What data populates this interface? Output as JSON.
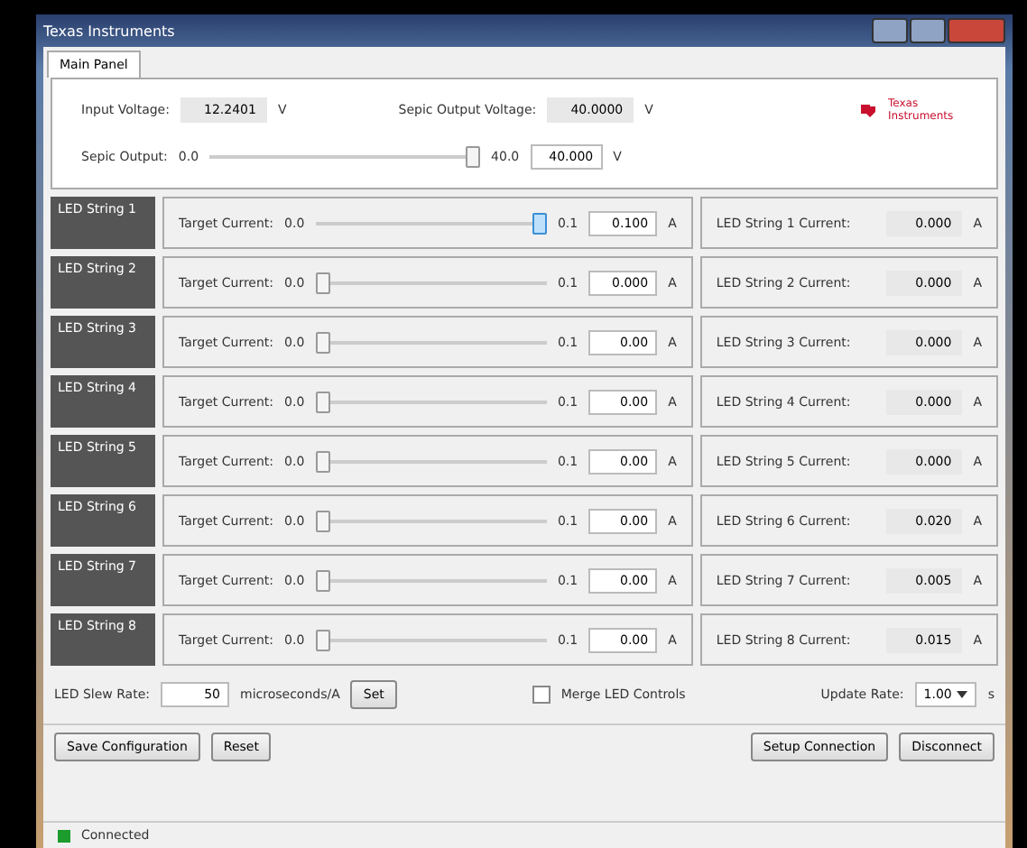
{
  "window": {
    "title": "Texas Instruments"
  },
  "tabs": [
    {
      "label": "Main Panel",
      "selected": true
    }
  ],
  "header": {
    "input_voltage": {
      "label": "Input Voltage:",
      "value": "12.2401",
      "unit": "V"
    },
    "sepic_voltage": {
      "label": "Sepic Output Voltage:",
      "value": "40.0000",
      "unit": "V"
    },
    "logo": "Texas Instruments",
    "sepic_output": {
      "label": "Sepic Output:",
      "min": "0.0",
      "max": "40.0",
      "level": 1,
      "value": "40.000",
      "unit": "V"
    }
  },
  "strings": [
    {
      "name": "LED String 1",
      "target_label": "Target Current:",
      "min": "0.0",
      "max": "0.1",
      "level": 1,
      "focused": true,
      "value": "0.100",
      "unit": "A",
      "current_label": "LED String 1 Current:",
      "current": "0.000",
      "current_unit": "A"
    },
    {
      "name": "LED String 2",
      "target_label": "Target Current:",
      "min": "0.0",
      "max": "0.1",
      "level": 0,
      "focused": false,
      "value": "0.000",
      "unit": "A",
      "current_label": "LED String 2 Current:",
      "current": "0.000",
      "current_unit": "A"
    },
    {
      "name": "LED String 3",
      "target_label": "Target Current:",
      "min": "0.0",
      "max": "0.1",
      "level": 0,
      "focused": false,
      "value": "0.00",
      "unit": "A",
      "current_label": "LED String 3 Current:",
      "current": "0.000",
      "current_unit": "A"
    },
    {
      "name": "LED String 4",
      "target_label": "Target Current:",
      "min": "0.0",
      "max": "0.1",
      "level": 0,
      "focused": false,
      "value": "0.00",
      "unit": "A",
      "current_label": "LED String 4 Current:",
      "current": "0.000",
      "current_unit": "A"
    },
    {
      "name": "LED String 5",
      "target_label": "Target Current:",
      "min": "0.0",
      "max": "0.1",
      "level": 0,
      "focused": false,
      "value": "0.00",
      "unit": "A",
      "current_label": "LED String 5 Current:",
      "current": "0.000",
      "current_unit": "A"
    },
    {
      "name": "LED String 6",
      "target_label": "Target Current:",
      "min": "0.0",
      "max": "0.1",
      "level": 0,
      "focused": false,
      "value": "0.00",
      "unit": "A",
      "current_label": "LED String 6 Current:",
      "current": "0.020",
      "current_unit": "A"
    },
    {
      "name": "LED String 7",
      "target_label": "Target Current:",
      "min": "0.0",
      "max": "0.1",
      "level": 0,
      "focused": false,
      "value": "0.00",
      "unit": "A",
      "current_label": "LED String 7 Current:",
      "current": "0.005",
      "current_unit": "A"
    },
    {
      "name": "LED String 8",
      "target_label": "Target Current:",
      "min": "0.0",
      "max": "0.1",
      "level": 0,
      "focused": false,
      "value": "0.00",
      "unit": "A",
      "current_label": "LED String 8 Current:",
      "current": "0.015",
      "current_unit": "A"
    }
  ],
  "slew": {
    "label": "LED Slew Rate:",
    "value": "50",
    "unit": "microseconds/A",
    "button": "Set"
  },
  "merge": {
    "label": "Merge LED Controls",
    "checked": false
  },
  "update_rate": {
    "label": "Update Rate:",
    "value": "1.00",
    "unit": "s"
  },
  "buttons_left": [
    "Save Configuration",
    "Reset"
  ],
  "buttons_right": [
    "Setup Connection",
    "Disconnect"
  ],
  "status": {
    "text": "Connected",
    "connected": true
  }
}
